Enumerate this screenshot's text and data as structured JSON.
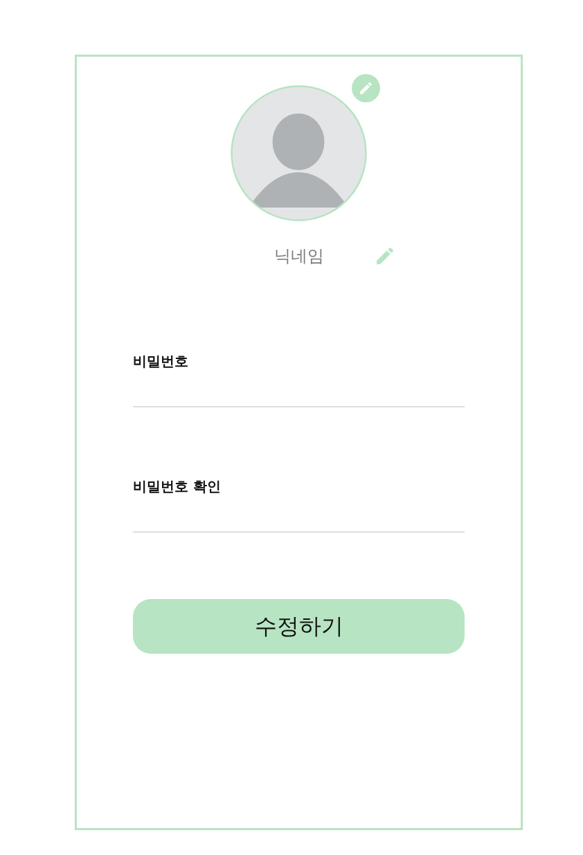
{
  "profile": {
    "nickname": "닉네임"
  },
  "fields": [
    {
      "label": "비밀번호"
    },
    {
      "label": "비밀번호 확인"
    }
  ],
  "submit_button": {
    "label": "수정하기"
  }
}
